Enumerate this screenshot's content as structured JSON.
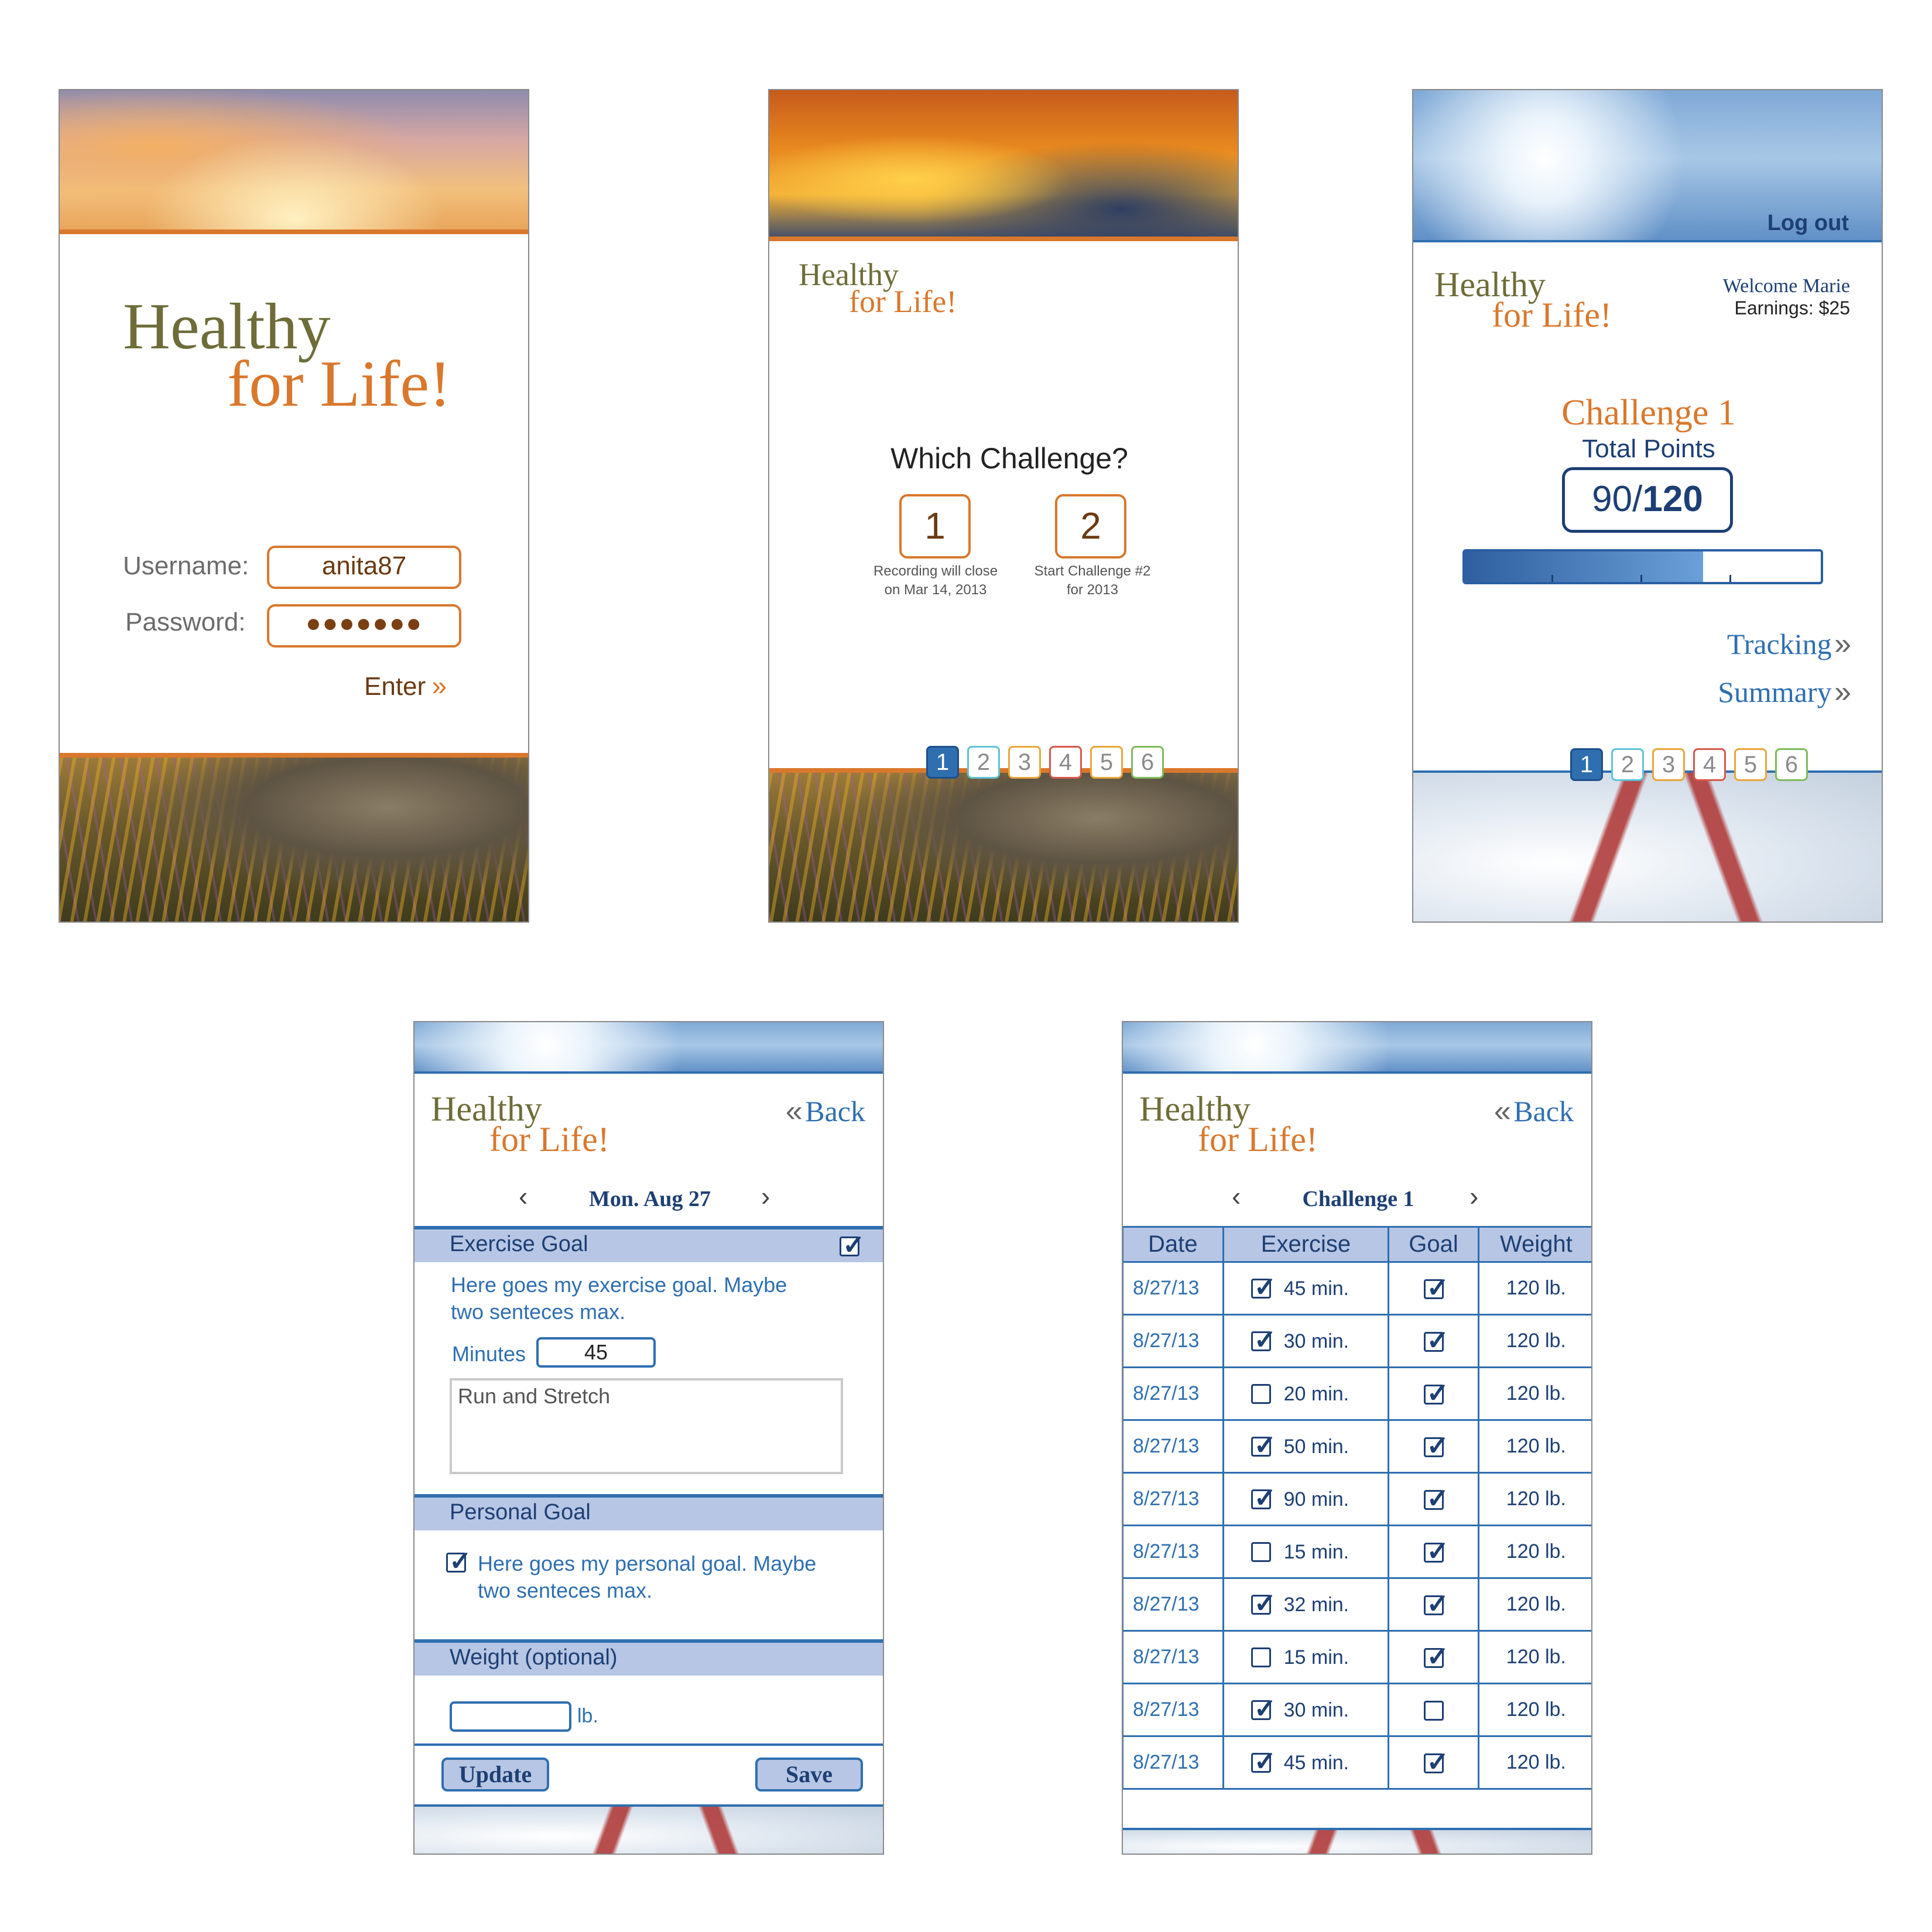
{
  "app": {
    "logo_line1": "Healthy",
    "logo_line2": "for Life!"
  },
  "login": {
    "username_label": "Username:",
    "username_value": "anita87",
    "password_label": "Password:",
    "password_value": "●●●●●●●",
    "enter_label": "Enter"
  },
  "challenge_select": {
    "question": "Which Challenge?",
    "options": [
      {
        "number": "1",
        "caption_line1": "Recording will close",
        "caption_line2": "on Mar 14, 2013"
      },
      {
        "number": "2",
        "caption_line1": "Start Challenge #2",
        "caption_line2": "for 2013"
      }
    ]
  },
  "pager": {
    "pages": [
      "1",
      "2",
      "3",
      "4",
      "5",
      "6"
    ],
    "active_page": "1",
    "colors": [
      "#2f6fb0",
      "#5ec3d8",
      "#e9a63a",
      "#d6584a",
      "#e9a63a",
      "#7dbb5a"
    ]
  },
  "dashboard": {
    "logout": "Log out",
    "welcome": "Welcome Marie",
    "earnings": "Earnings: $25",
    "challenge_title": "Challenge 1",
    "points_label": "Total Points",
    "points_current": "90",
    "points_separator": "/",
    "points_total": "120",
    "progress_fraction": 0.67,
    "tracking_link": "Tracking",
    "summary_link": "Summary"
  },
  "daily_entry": {
    "back": "Back",
    "date": "Mon. Aug 27",
    "exercise_section": "Exercise Goal",
    "exercise_goal_text_line1": "Here goes my exercise goal. Maybe",
    "exercise_goal_text_line2": "two senteces max.",
    "minutes_label": "Minutes",
    "minutes_value": "45",
    "activity_text": "Run and Stretch",
    "personal_section": "Personal Goal",
    "personal_goal_text_line1": "Here goes my personal goal. Maybe",
    "personal_goal_text_line2": "two senteces max.",
    "weight_section": "Weight (optional)",
    "weight_unit": "lb.",
    "update_label": "Update",
    "save_label": "Save"
  },
  "summary": {
    "back": "Back",
    "title": "Challenge 1",
    "columns": [
      "Date",
      "Exercise",
      "Goal",
      "Weight"
    ],
    "rows": [
      {
        "date": "8/27/13",
        "exercise_done": true,
        "minutes": "45 min.",
        "goal": true,
        "weight": "120 lb."
      },
      {
        "date": "8/27/13",
        "exercise_done": true,
        "minutes": "30 min.",
        "goal": true,
        "weight": "120 lb."
      },
      {
        "date": "8/27/13",
        "exercise_done": false,
        "minutes": "20 min.",
        "goal": true,
        "weight": "120 lb."
      },
      {
        "date": "8/27/13",
        "exercise_done": true,
        "minutes": "50 min.",
        "goal": true,
        "weight": "120 lb."
      },
      {
        "date": "8/27/13",
        "exercise_done": true,
        "minutes": "90 min.",
        "goal": true,
        "weight": "120 lb."
      },
      {
        "date": "8/27/13",
        "exercise_done": false,
        "minutes": "15 min.",
        "goal": true,
        "weight": "120 lb."
      },
      {
        "date": "8/27/13",
        "exercise_done": true,
        "minutes": "32 min.",
        "goal": true,
        "weight": "120 lb."
      },
      {
        "date": "8/27/13",
        "exercise_done": false,
        "minutes": "15 min.",
        "goal": true,
        "weight": "120 lb."
      },
      {
        "date": "8/27/13",
        "exercise_done": true,
        "minutes": "30 min.",
        "goal": false,
        "weight": "120 lb."
      },
      {
        "date": "8/27/13",
        "exercise_done": true,
        "minutes": "45 min.",
        "goal": true,
        "weight": "120 lb."
      }
    ]
  }
}
